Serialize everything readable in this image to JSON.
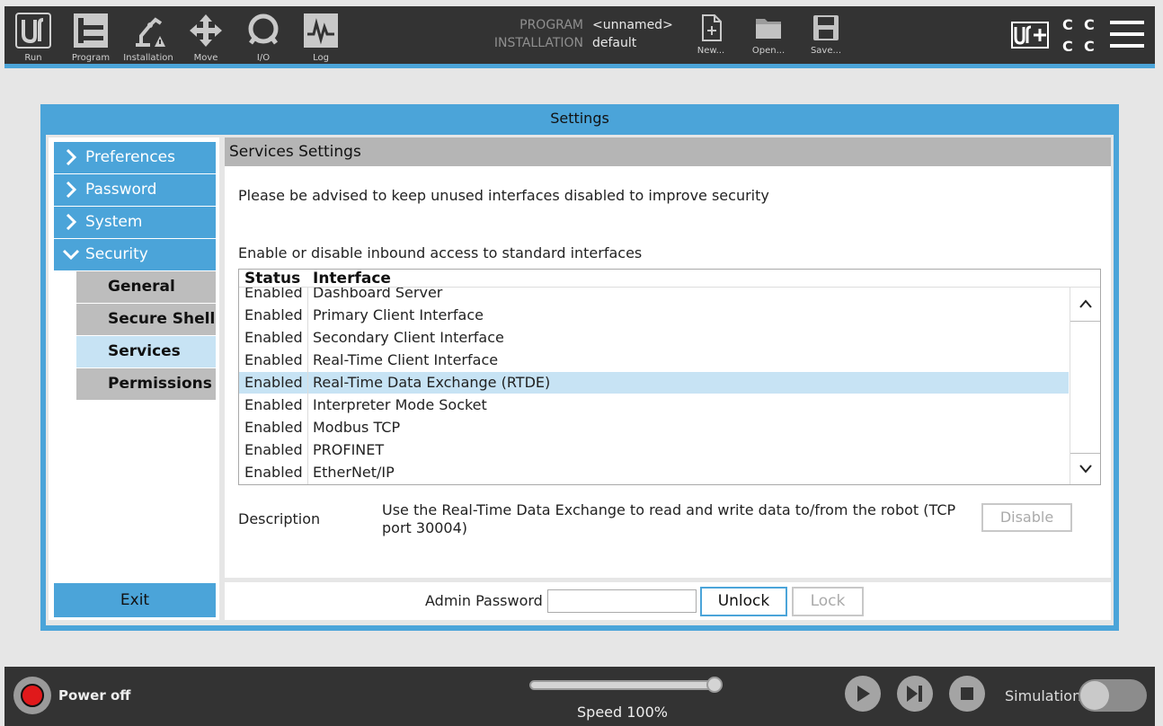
{
  "toolbar": {
    "items": [
      {
        "label": "Run",
        "icon": "ur-logo-icon"
      },
      {
        "label": "Program",
        "icon": "program-tree-icon"
      },
      {
        "label": "Installation",
        "icon": "robot-arm-warning-icon"
      },
      {
        "label": "Move",
        "icon": "move-arrows-icon"
      },
      {
        "label": "I/O",
        "icon": "io-icon"
      },
      {
        "label": "Log",
        "icon": "log-waveform-icon"
      }
    ],
    "program_label": "PROGRAM",
    "program_value": "<unnamed>",
    "installation_label": "INSTALLATION",
    "installation_value": "default",
    "file_buttons": [
      {
        "label": "New...",
        "icon": "new-file-icon"
      },
      {
        "label": "Open...",
        "icon": "folder-icon"
      },
      {
        "label": "Save...",
        "icon": "save-disk-icon"
      }
    ],
    "status_grid": [
      "C",
      "C",
      "C",
      "C"
    ]
  },
  "dialog": {
    "title": "Settings",
    "nav": [
      {
        "label": "Preferences",
        "expanded": false
      },
      {
        "label": "Password",
        "expanded": false
      },
      {
        "label": "System",
        "expanded": false
      },
      {
        "label": "Security",
        "expanded": true
      }
    ],
    "subnav": [
      {
        "label": "General",
        "active": false
      },
      {
        "label": "Secure Shell",
        "active": false
      },
      {
        "label": "Services",
        "active": true
      },
      {
        "label": "Permissions",
        "active": false
      }
    ],
    "exit_label": "Exit",
    "panel": {
      "title": "Services Settings",
      "advisory": "Please be advised to keep unused interfaces disabled to improve security",
      "subheading": "Enable or disable inbound access to standard interfaces",
      "columns": [
        "Status",
        "Interface"
      ],
      "rows": [
        {
          "status": "Enabled",
          "interface": "Dashboard Server"
        },
        {
          "status": "Enabled",
          "interface": "Primary Client Interface"
        },
        {
          "status": "Enabled",
          "interface": "Secondary Client Interface"
        },
        {
          "status": "Enabled",
          "interface": "Real-Time Client Interface"
        },
        {
          "status": "Enabled",
          "interface": "Real-Time Data Exchange (RTDE)"
        },
        {
          "status": "Enabled",
          "interface": "Interpreter Mode Socket"
        },
        {
          "status": "Enabled",
          "interface": "Modbus TCP"
        },
        {
          "status": "Enabled",
          "interface": "PROFINET"
        },
        {
          "status": "Enabled",
          "interface": "EtherNet/IP"
        }
      ],
      "selected_row": 4,
      "description_label": "Description",
      "description_text": "Use the Real-Time Data Exchange to read and write data to/from the robot (TCP port 30004)",
      "disable_label": "Disable"
    },
    "admin": {
      "label": "Admin Password",
      "value": "",
      "unlock_label": "Unlock",
      "lock_label": "Lock"
    }
  },
  "bottom": {
    "power_label": "Power off",
    "speed_label": "Speed 100%",
    "speed_fraction": 1.0,
    "simulation_label": "Simulation",
    "simulation_on": false
  },
  "colors": {
    "accent": "#4ba4d9",
    "bar": "#333333",
    "selected": "#c7e3f4",
    "power": "#e0191b"
  }
}
